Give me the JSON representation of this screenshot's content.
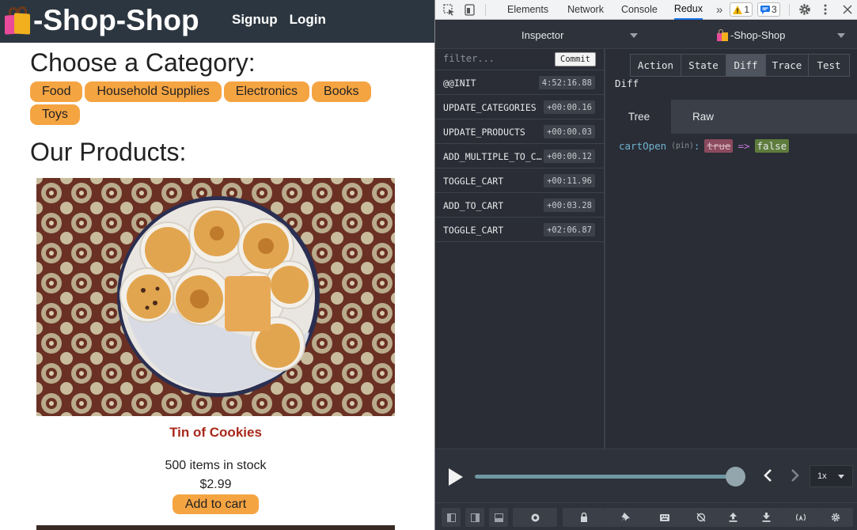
{
  "site": {
    "title": "-Shop-Shop",
    "nav": [
      "Signup",
      "Login"
    ],
    "category_heading": "Choose a Category:",
    "categories": [
      "Food",
      "Household Supplies",
      "Electronics",
      "Books",
      "Toys"
    ],
    "products_heading": "Our Products:",
    "product": {
      "name": "Tin of Cookies",
      "stock": "500 items in stock",
      "price": "$2.99",
      "add_label": "Add to cart"
    }
  },
  "devtools": {
    "tabs": [
      "Elements",
      "Network",
      "Console",
      "Redux"
    ],
    "active_tab": "Redux",
    "more": "»",
    "warnings": "1",
    "messages": "3",
    "inspector_label": "Inspector",
    "instance_label": "-Shop-Shop",
    "filter_placeholder": "filter...",
    "commit_label": "Commit",
    "actions": [
      {
        "name": "@@INIT",
        "time": "4:52:16.88"
      },
      {
        "name": "UPDATE_CATEGORIES",
        "time": "+00:00.16"
      },
      {
        "name": "UPDATE_PRODUCTS",
        "time": "+00:00.03"
      },
      {
        "name": "ADD_MULTIPLE_TO_CART",
        "time": "+00:00.12"
      },
      {
        "name": "TOGGLE_CART",
        "time": "+00:11.96"
      },
      {
        "name": "ADD_TO_CART",
        "time": "+00:03.28"
      },
      {
        "name": "TOGGLE_CART",
        "time": "+02:06.87"
      }
    ],
    "monitor_tabs": [
      "Action",
      "State",
      "Diff",
      "Trace",
      "Test"
    ],
    "active_monitor_tab": "Diff",
    "monitor_title": "Diff",
    "view_tabs": [
      "Tree",
      "Raw"
    ],
    "diff": {
      "key": "cartOpen",
      "pin": "(pin)",
      "colon": ":",
      "old": "true",
      "arrow": "=>",
      "new": "false"
    },
    "speed": "1x"
  }
}
